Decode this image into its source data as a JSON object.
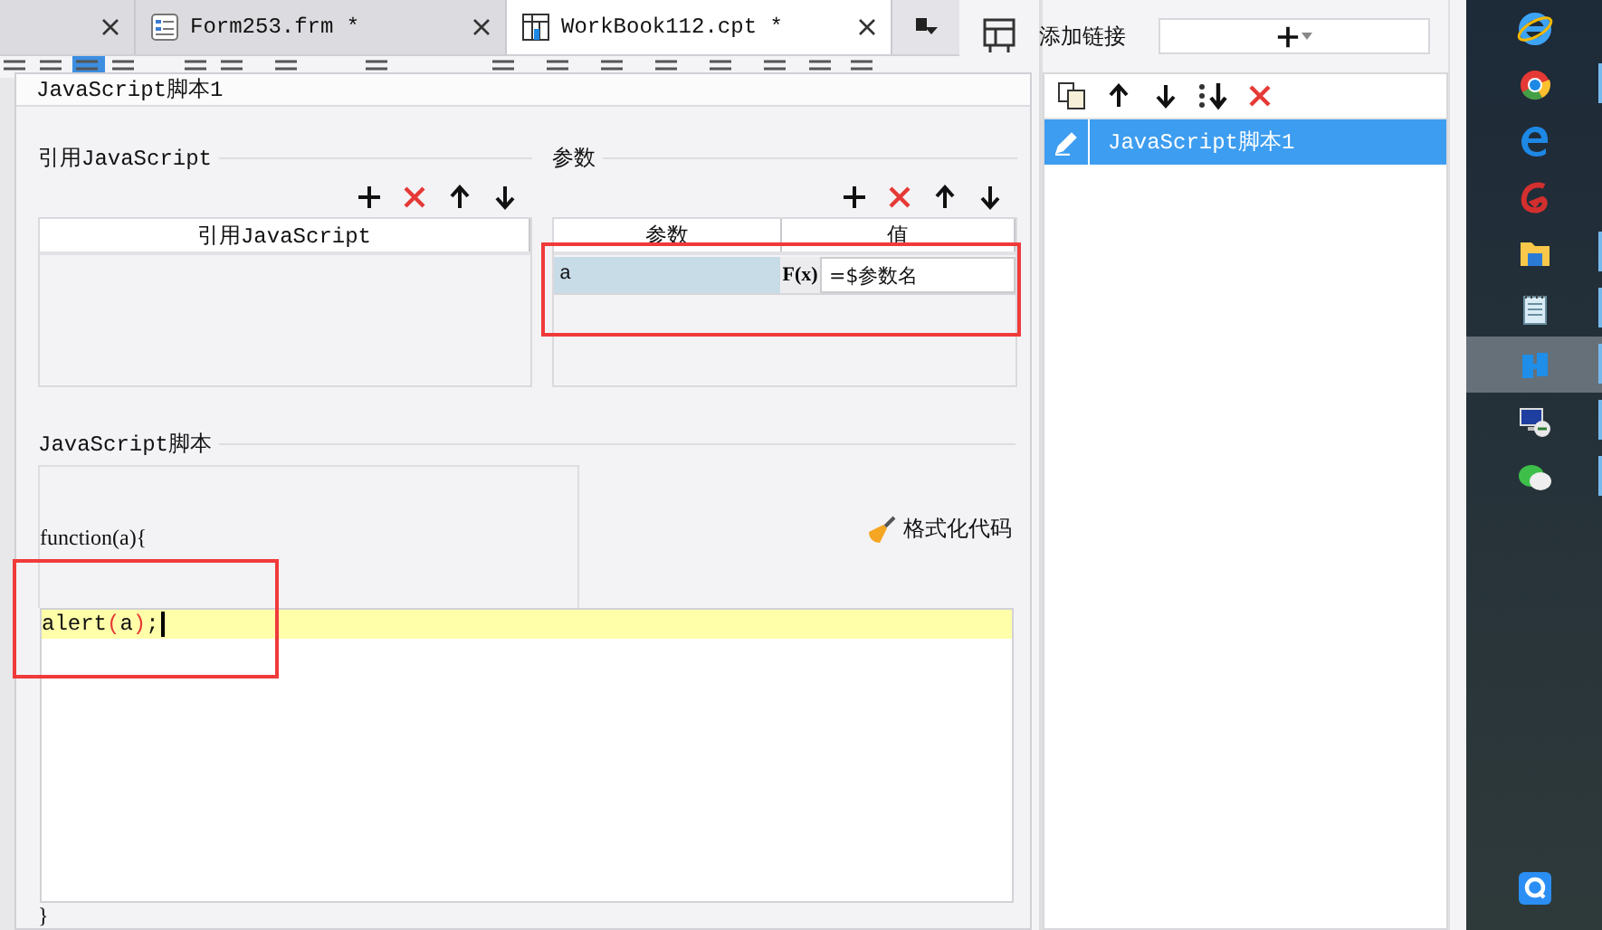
{
  "editor_tabs": [
    {
      "selected": false,
      "kind": "partial"
    },
    {
      "label": "Form253.frm *",
      "selected": false,
      "kind": "form"
    },
    {
      "label": "WorkBook112.cpt *",
      "selected": true,
      "kind": "workbook"
    }
  ],
  "dialog": {
    "title": "JavaScript脚本1",
    "references": {
      "heading": "引用JavaScript",
      "column": "引用JavaScript"
    },
    "parameters": {
      "heading": "参数",
      "columns": [
        "参数",
        "值"
      ],
      "formula_label": "F(x)",
      "rows": [
        {
          "name": "a",
          "value": "=$参数名",
          "selected": true
        }
      ]
    },
    "script": {
      "heading": "JavaScript脚本",
      "signature": "function(a){",
      "format_button": "格式化代码",
      "lines": [
        {
          "current": true,
          "tokens": [
            {
              "text": "alert",
              "kind": "plain"
            },
            {
              "text": "(",
              "kind": "paren"
            },
            {
              "text": "a",
              "kind": "plain"
            },
            {
              "text": ")",
              "kind": "paren"
            },
            {
              "text": ";",
              "kind": "plain"
            }
          ]
        }
      ],
      "closing": "}"
    }
  },
  "links_panel": {
    "label": "添加链接",
    "items": [
      {
        "label": "JavaScript脚本1",
        "selected": true
      }
    ]
  },
  "taskbar": {
    "top": [
      {
        "kind": "ie",
        "running": false,
        "active": false
      },
      {
        "kind": "chrome",
        "running": true,
        "active": false
      },
      {
        "kind": "edge",
        "running": false,
        "active": false
      },
      {
        "kind": "red-g",
        "running": false,
        "active": false
      },
      {
        "kind": "folder",
        "running": true,
        "active": false
      },
      {
        "kind": "notepad",
        "running": true,
        "active": false
      },
      {
        "kind": "report",
        "running": true,
        "active": true
      },
      {
        "kind": "remote",
        "running": true,
        "active": false
      },
      {
        "kind": "chat",
        "running": true,
        "active": false
      }
    ],
    "bottom": [
      {
        "kind": "q",
        "running": false,
        "active": false
      }
    ]
  }
}
